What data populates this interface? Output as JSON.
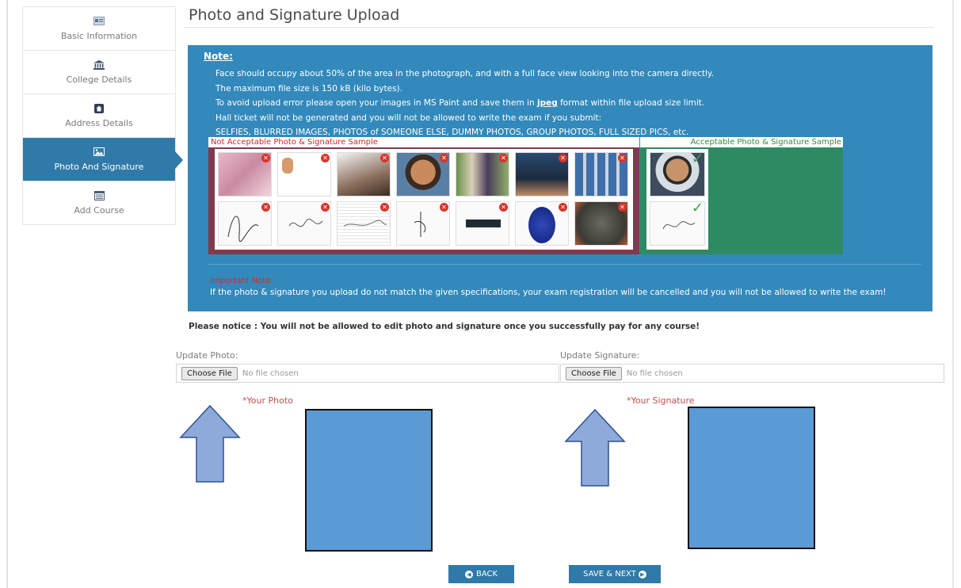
{
  "sidebar": {
    "items": [
      {
        "label": "Basic Information",
        "icon": "id-card-icon"
      },
      {
        "label": "College Details",
        "icon": "institution-icon"
      },
      {
        "label": "Address Details",
        "icon": "home-icon"
      },
      {
        "label": "Photo And Signature",
        "icon": "image-icon",
        "active": true
      },
      {
        "label": "Add Course",
        "icon": "list-icon"
      }
    ]
  },
  "page": {
    "title": "Photo and Signature Upload"
  },
  "note": {
    "title": "Note:",
    "line1": "Face should occupy about 50% of the area in the photograph, and with a full face view looking into the camera directly.",
    "line2": "The maximum file size is 150 kB (kilo bytes).",
    "line3a": "To avoid upload error please open your images in MS Paint and save them in ",
    "line3b": "jpeg",
    "line3c": " format within file upload size limit.",
    "line4": "Hall ticket will not be generated and you will not be allowed to write the exam if you submit:",
    "line5": "SELFIES, BLURRED IMAGES, PHOTOS of SOMEONE ELSE, DUMMY PHOTOS, GROUP PHOTOS, FULL SIZED PICS, etc.",
    "not_acceptable_label": "Not Acceptable Photo & Signature Sample",
    "acceptable_label": "Acceptable Photo & Signature Sample",
    "important_title": "Important Note:",
    "important_text": "If the photo & signature you upload do not match the given specifications, your exam registration will be cancelled and you will not be allowed to write the exam!"
  },
  "notice": "Please notice : You will not be allowed to edit photo and signature once you successfully pay for any course!",
  "upload": {
    "photo_label": "Update Photo:",
    "signature_label": "Update Signature:",
    "choose_file": "Choose File",
    "no_file": "No file chosen",
    "your_photo": "*Your Photo",
    "your_signature": "*Your Signature"
  },
  "buttons": {
    "back": "BACK",
    "save_next": "SAVE & NEXT"
  },
  "colors": {
    "primary": "#2f7aa8",
    "panel": "#3389bb",
    "reject": "#7e3a4e",
    "accept": "#2e8a62",
    "preview": "#5b9bd5",
    "arrow": "#8eaadb"
  }
}
